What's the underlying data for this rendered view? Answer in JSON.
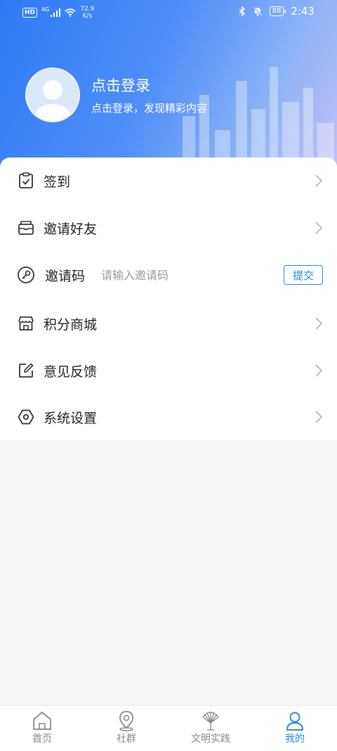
{
  "status_bar": {
    "hd": "HD",
    "network": "4G",
    "speed_value": "72.9",
    "speed_unit": "K/s",
    "battery": "88",
    "time": "2:43"
  },
  "profile": {
    "title": "点击登录",
    "subtitle": "点击登录，发现精彩内容"
  },
  "menu": {
    "checkin": "签到",
    "invite_friends": "邀请好友",
    "invite_code": "邀请码",
    "invite_placeholder": "请输入邀请码",
    "submit": "提交",
    "points_mall": "积分商城",
    "feedback": "意见反馈",
    "settings": "系统设置"
  },
  "tabs": [
    {
      "label": "首页",
      "icon": "home-icon",
      "active": false
    },
    {
      "label": "社群",
      "icon": "location-pin-icon",
      "active": false
    },
    {
      "label": "文明实践",
      "icon": "fan-emblem-icon",
      "active": false
    },
    {
      "label": "我的",
      "icon": "user-icon",
      "active": true
    }
  ],
  "colors": {
    "accent": "#2a85e8",
    "header_start": "#2f7af6",
    "header_end": "#c6bff6"
  }
}
